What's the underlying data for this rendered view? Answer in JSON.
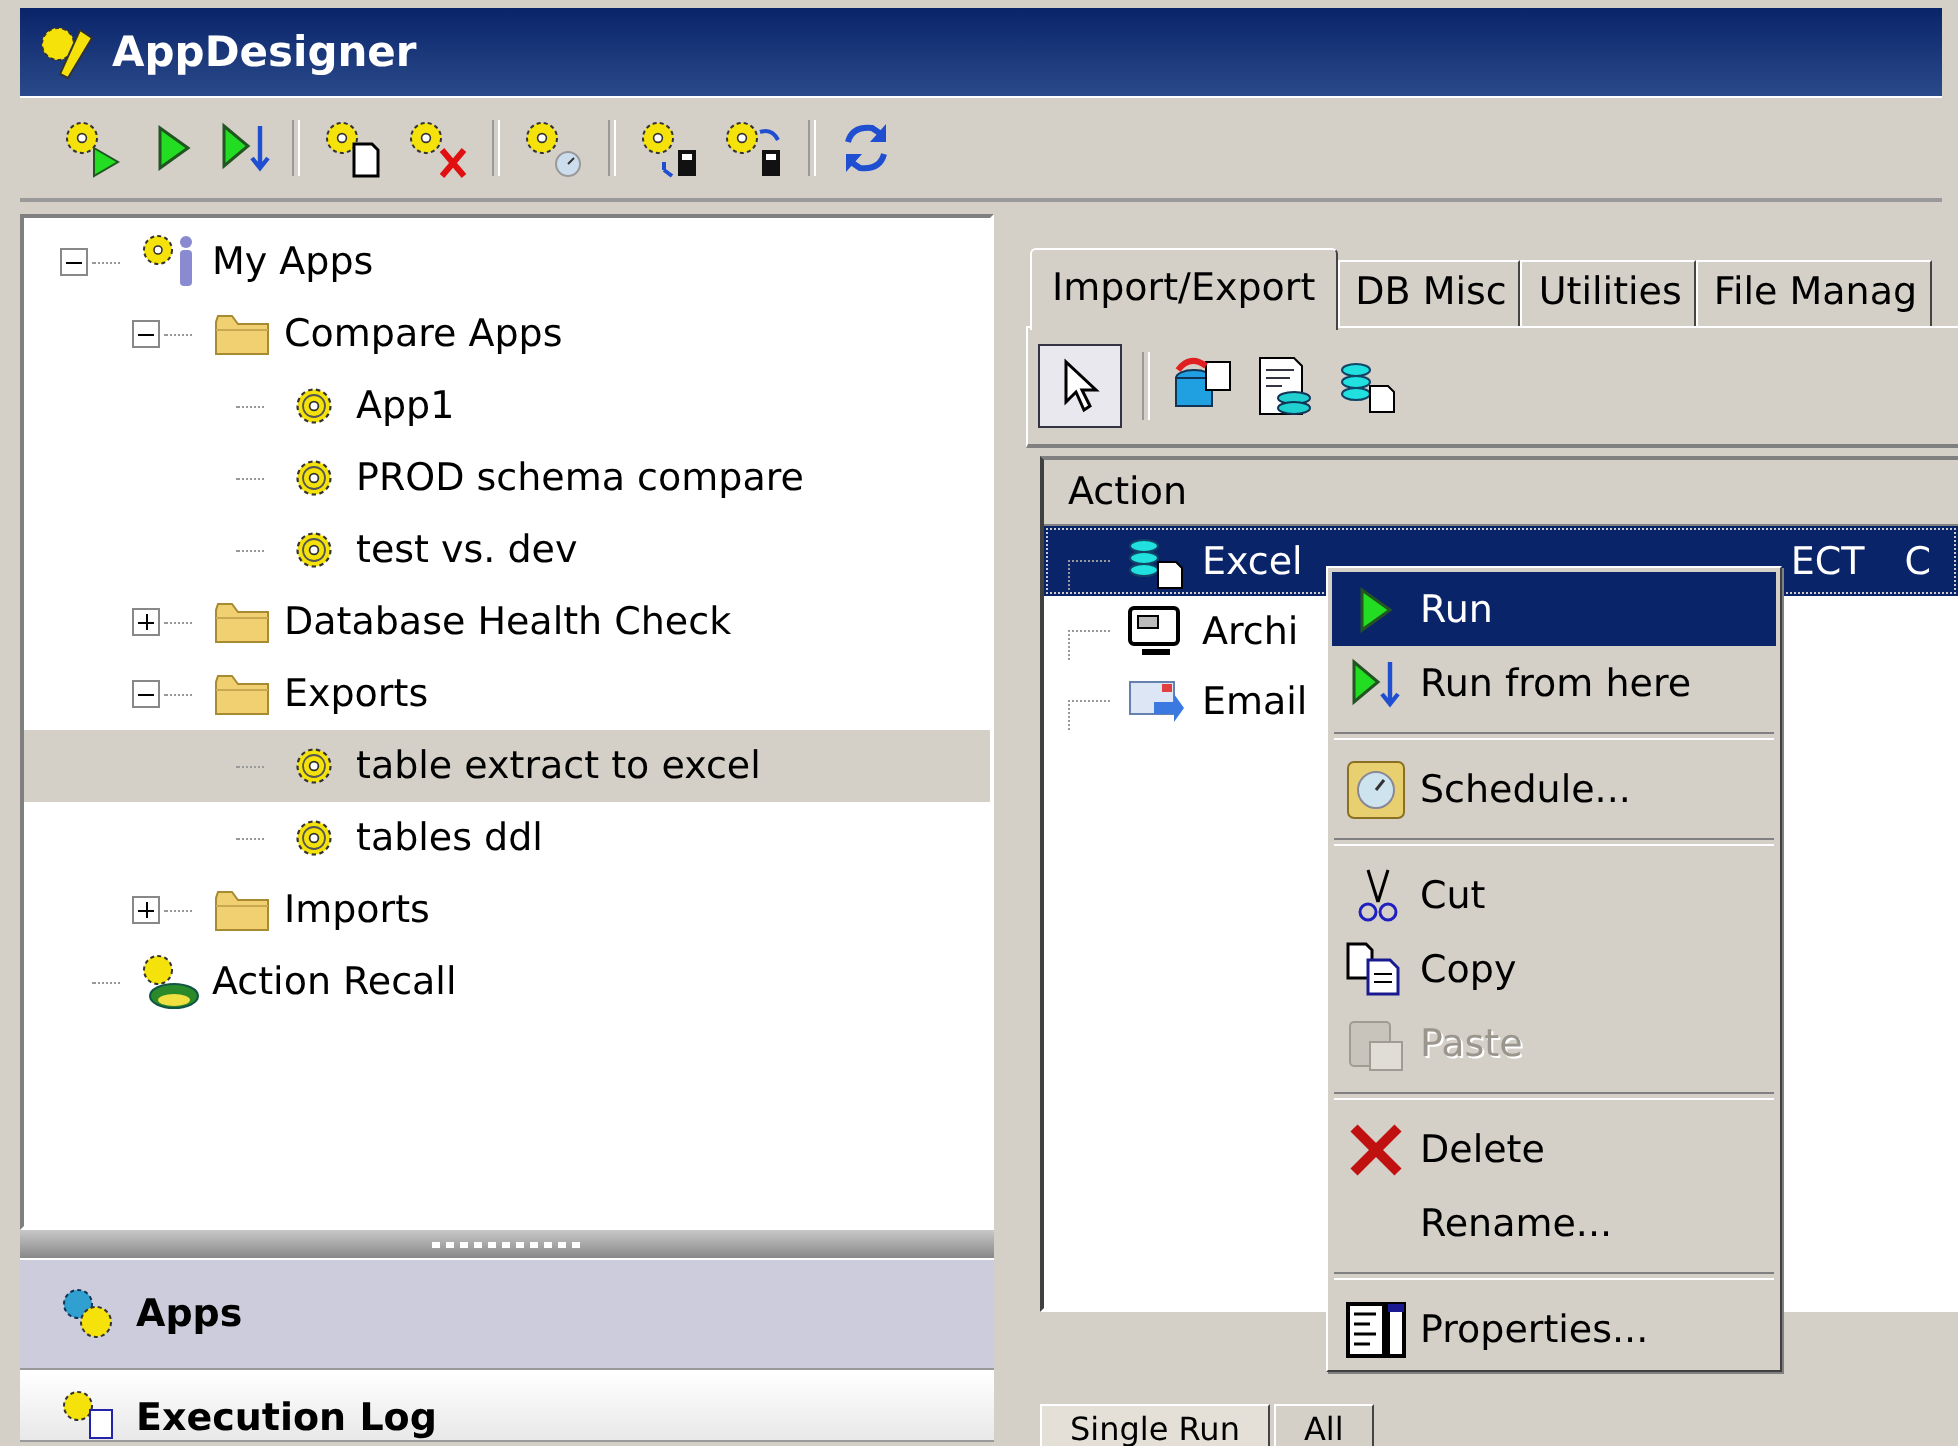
{
  "window": {
    "title": "AppDesigner"
  },
  "tree": [
    {
      "label": "My Apps",
      "kind": "root",
      "expanded": true,
      "selected": false,
      "children": [
        {
          "label": "Compare Apps",
          "kind": "folder",
          "expanded": true,
          "selected": false,
          "children": [
            {
              "label": "App1",
              "kind": "app",
              "selected": false
            },
            {
              "label": "PROD schema compare",
              "kind": "app",
              "selected": false
            },
            {
              "label": "test vs. dev",
              "kind": "app",
              "selected": false
            }
          ]
        },
        {
          "label": "Database Health Check",
          "kind": "folder",
          "expanded": false,
          "selected": false
        },
        {
          "label": "Exports",
          "kind": "folder",
          "expanded": true,
          "selected": false,
          "children": [
            {
              "label": "table extract to excel",
              "kind": "app",
              "selected": true
            },
            {
              "label": "tables ddl",
              "kind": "app",
              "selected": false
            }
          ]
        },
        {
          "label": "Imports",
          "kind": "folder",
          "expanded": false,
          "selected": false
        }
      ]
    },
    {
      "label": "Action Recall",
      "kind": "recall",
      "selected": false
    }
  ],
  "nav_panels": [
    {
      "label": "Apps",
      "selected": true
    },
    {
      "label": "Execution Log",
      "selected": false
    }
  ],
  "tabs": [
    {
      "label": "Import/Export",
      "selected": true
    },
    {
      "label": "DB Misc",
      "selected": false
    },
    {
      "label": "Utilities",
      "selected": false
    },
    {
      "label": "File Manag",
      "selected": false
    }
  ],
  "action_list": {
    "column": "Action",
    "rows": [
      {
        "label": "Excel",
        "label_tail": "ECT",
        "column_2": "C",
        "selected": true
      },
      {
        "label": "Archi",
        "selected": false
      },
      {
        "label": "Email",
        "selected": false
      }
    ]
  },
  "context_menu": [
    {
      "kind": "item",
      "label": "Run",
      "selected": true,
      "disabled": false
    },
    {
      "kind": "item",
      "label": "Run from here",
      "selected": false,
      "disabled": false
    },
    {
      "kind": "separator"
    },
    {
      "kind": "item",
      "label": "Schedule...",
      "selected": false,
      "disabled": false
    },
    {
      "kind": "separator"
    },
    {
      "kind": "item",
      "label": "Cut",
      "selected": false,
      "disabled": false
    },
    {
      "kind": "item",
      "label": "Copy",
      "selected": false,
      "disabled": false
    },
    {
      "kind": "item",
      "label": "Paste",
      "selected": false,
      "disabled": true
    },
    {
      "kind": "separator"
    },
    {
      "kind": "item",
      "label": "Delete",
      "selected": false,
      "disabled": false
    },
    {
      "kind": "item",
      "label": "Rename...",
      "selected": false,
      "disabled": false
    },
    {
      "kind": "separator"
    },
    {
      "kind": "item",
      "label": "Properties...",
      "selected": false,
      "disabled": false
    }
  ],
  "bottom_tabs": [
    {
      "label": "Single Run",
      "selected": true
    },
    {
      "label": "All",
      "selected": false
    }
  ]
}
